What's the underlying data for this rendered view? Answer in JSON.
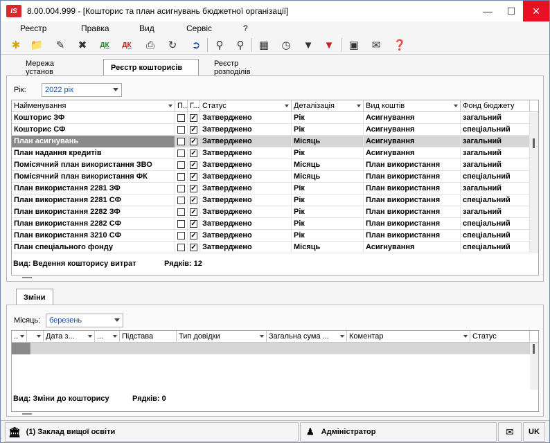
{
  "window": {
    "title": "8.00.004.999 - [Кошторис та план асигнувань бюджетної організації]",
    "logo": "IS"
  },
  "menu": [
    "Реєстр",
    "Правка",
    "Вид",
    "Сервіс",
    "?"
  ],
  "toolbar_icons": [
    "new-doc-icon",
    "open-folder-icon",
    "edit-icon",
    "delete-icon",
    "dk-green-icon",
    "dk-red-icon",
    "print-icon",
    "refresh-icon",
    "exit-icon",
    "find-icon",
    "find-next-icon",
    "table-icon",
    "calendar-clock-icon",
    "filter-icon",
    "clear-filter-icon",
    "doc-view-icon",
    "mail-icon",
    "help-icon"
  ],
  "tabs": [
    "Мережа установ",
    "Реєстр кошторисів",
    "Реєстр розподілів"
  ],
  "year": {
    "label": "Рік:",
    "value": "2022 рік"
  },
  "top_grid": {
    "headers": [
      "Найменування",
      "П...",
      "Г...",
      "Статус",
      "Деталізація",
      "Вид коштів",
      "Фонд бюджету"
    ],
    "rows": [
      {
        "name": "Кошторис ЗФ",
        "p": false,
        "g": true,
        "status": "Затверджено",
        "detail": "Рік",
        "kind": "Асигнування",
        "fund": "загальний"
      },
      {
        "name": "Кошторис СФ",
        "p": false,
        "g": true,
        "status": "Затверджено",
        "detail": "Рік",
        "kind": "Асигнування",
        "fund": "спеціальний"
      },
      {
        "name": "План асигнувань",
        "p": false,
        "g": true,
        "status": "Затверджено",
        "detail": "Місяць",
        "kind": "Асигнування",
        "fund": "загальний"
      },
      {
        "name": "План надання кредитів",
        "p": false,
        "g": true,
        "status": "Затверджено",
        "detail": "Рік",
        "kind": "Асигнування",
        "fund": "загальний"
      },
      {
        "name": "Помісячний план використання ЗВО",
        "p": false,
        "g": true,
        "status": "Затверджено",
        "detail": "Місяць",
        "kind": "План використання",
        "fund": "загальний"
      },
      {
        "name": "Помісячний план використання ФК",
        "p": false,
        "g": true,
        "status": "Затверджено",
        "detail": "Місяць",
        "kind": "План використання",
        "fund": "спеціальний"
      },
      {
        "name": "План використання 2281 ЗФ",
        "p": false,
        "g": true,
        "status": "Затверджено",
        "detail": "Рік",
        "kind": "План використання",
        "fund": "загальний"
      },
      {
        "name": "План використання 2281 СФ",
        "p": false,
        "g": true,
        "status": "Затверджено",
        "detail": "Рік",
        "kind": "План використання",
        "fund": "спеціальний"
      },
      {
        "name": "План використання 2282 ЗФ",
        "p": false,
        "g": true,
        "status": "Затверджено",
        "detail": "Рік",
        "kind": "План використання",
        "fund": "загальний"
      },
      {
        "name": "План використання 2282 СФ",
        "p": false,
        "g": true,
        "status": "Затверджено",
        "detail": "Рік",
        "kind": "План використання",
        "fund": "спеціальний"
      },
      {
        "name": "План використання 3210 СФ",
        "p": false,
        "g": true,
        "status": "Затверджено",
        "detail": "Рік",
        "kind": "План використання",
        "fund": "спеціальний"
      },
      {
        "name": "План спеціального фонду",
        "p": false,
        "g": true,
        "status": "Затверджено",
        "detail": "Місяць",
        "kind": "Асигнування",
        "fund": "спеціальний"
      }
    ],
    "selected_index": 2,
    "footer_view": "Вид: Ведення кошторису витрат",
    "footer_rows": "Рядків: 12"
  },
  "bottom_tab": "Зміни",
  "month": {
    "label": "Місяць:",
    "value": "березень"
  },
  "bottom_grid": {
    "headers": [
      "..",
      "",
      "Дата з...",
      "...",
      "Підстава",
      "Тип довідки",
      "Загальна сума ...",
      "Коментар",
      "Статус"
    ],
    "footer_view": "Вид: Зміни до кошторису",
    "footer_rows": "Рядків: 0"
  },
  "status": {
    "org": "(1) Заклад вищої освіти",
    "user": "Адміністратор",
    "lang": "UK"
  }
}
